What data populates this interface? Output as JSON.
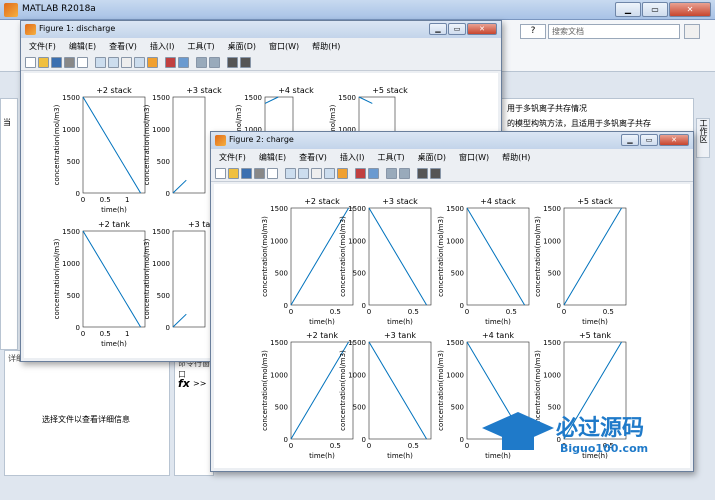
{
  "app": {
    "title": "MATLAB R2018a",
    "search_placeholder": "搜索文档",
    "help": "?"
  },
  "main": {
    "cmd_label": "命令行窗口",
    "fx": "fx",
    "prompt": ">>",
    "details_label": "详细信息",
    "select_hint": "选择文件以查看详细信息",
    "side_cut": "当",
    "doc_line1": "用于多钒离子共存情况",
    "doc_line2": "的模型构筑方法，且适用于多钒离子共存",
    "right_tab": "工作区"
  },
  "fig1": {
    "title": "Figure 1: discharge"
  },
  "fig2": {
    "title": "Figure 2: charge"
  },
  "menu": [
    "文件(F)",
    "编辑(E)",
    "查看(V)",
    "插入(I)",
    "工具(T)",
    "桌面(D)",
    "窗口(W)",
    "帮助(H)"
  ],
  "axes_common": {
    "ylabel": "concentration(mol/m3)",
    "xlabel": "time(h)",
    "yticks": [
      "0",
      "500",
      "1000",
      "1500"
    ]
  },
  "chart_data": [
    {
      "type": "line",
      "figure": "Figure 1: discharge",
      "title": "+2 stack",
      "x": [
        0,
        1.3
      ],
      "y": [
        1500,
        0
      ],
      "xlim": [
        0,
        1.4
      ],
      "ylim": [
        0,
        1500
      ],
      "xticks": [
        "0",
        "0.5",
        "1"
      ]
    },
    {
      "type": "line",
      "figure": "Figure 1: discharge",
      "title": "+3 stack",
      "x": [
        0,
        0.3
      ],
      "y": [
        0,
        200
      ],
      "xlim": [
        0,
        1.4
      ],
      "ylim": [
        0,
        1500
      ]
    },
    {
      "type": "line",
      "figure": "Figure 1: discharge",
      "title": "+4 stack",
      "x": [
        0,
        0.3
      ],
      "y": [
        1400,
        1500
      ],
      "xlim": [
        0,
        1.4
      ],
      "ylim": [
        0,
        1500
      ]
    },
    {
      "type": "line",
      "figure": "Figure 1: discharge",
      "title": "+5 stack",
      "x": [
        0,
        0.3
      ],
      "y": [
        1500,
        1400
      ],
      "xlim": [
        0,
        1.4
      ],
      "ylim": [
        0,
        1500
      ]
    },
    {
      "type": "line",
      "figure": "Figure 1: discharge",
      "title": "+2 tank",
      "x": [
        0,
        1.3
      ],
      "y": [
        1500,
        0
      ],
      "xlim": [
        0,
        1.4
      ],
      "ylim": [
        0,
        1500
      ],
      "xticks": [
        "0",
        "0.5",
        "1"
      ]
    },
    {
      "type": "line",
      "figure": "Figure 1: discharge",
      "title": "+3 tank",
      "x": [
        0,
        0.3
      ],
      "y": [
        0,
        200
      ],
      "xlim": [
        0,
        1.4
      ],
      "ylim": [
        0,
        1500
      ]
    },
    {
      "type": "line",
      "figure": "Figure 2: charge",
      "title": "+2 stack",
      "x": [
        0,
        0.65
      ],
      "y": [
        0,
        1500
      ],
      "xlim": [
        0,
        0.7
      ],
      "ylim": [
        0,
        1500
      ],
      "xticks": [
        "0",
        "0.5"
      ]
    },
    {
      "type": "line",
      "figure": "Figure 2: charge",
      "title": "+3 stack",
      "x": [
        0,
        0.65
      ],
      "y": [
        1500,
        0
      ],
      "xlim": [
        0,
        0.7
      ],
      "ylim": [
        0,
        1500
      ],
      "xticks": [
        "0",
        "0.5"
      ]
    },
    {
      "type": "line",
      "figure": "Figure 2: charge",
      "title": "+4 stack",
      "x": [
        0,
        0.65
      ],
      "y": [
        1500,
        0
      ],
      "xlim": [
        0,
        0.7
      ],
      "ylim": [
        0,
        1500
      ],
      "xticks": [
        "0",
        "0.5"
      ]
    },
    {
      "type": "line",
      "figure": "Figure 2: charge",
      "title": "+5 stack",
      "x": [
        0,
        0.65
      ],
      "y": [
        0,
        1500
      ],
      "xlim": [
        0,
        0.7
      ],
      "ylim": [
        0,
        1500
      ],
      "xticks": [
        "0",
        "0.5"
      ]
    },
    {
      "type": "line",
      "figure": "Figure 2: charge",
      "title": "+2 tank",
      "x": [
        0,
        0.65
      ],
      "y": [
        0,
        1500
      ],
      "xlim": [
        0,
        0.7
      ],
      "ylim": [
        0,
        1500
      ],
      "xticks": [
        "0",
        "0.5"
      ]
    },
    {
      "type": "line",
      "figure": "Figure 2: charge",
      "title": "+3 tank",
      "x": [
        0,
        0.65
      ],
      "y": [
        1500,
        0
      ],
      "xlim": [
        0,
        0.7
      ],
      "ylim": [
        0,
        1500
      ],
      "xticks": [
        "0",
        "0.5"
      ]
    },
    {
      "type": "line",
      "figure": "Figure 2: charge",
      "title": "+4 tank",
      "x": [
        0,
        0.65
      ],
      "y": [
        1500,
        0
      ],
      "xlim": [
        0,
        0.7
      ],
      "ylim": [
        0,
        1500
      ],
      "xticks": [
        "0",
        "0.5"
      ]
    },
    {
      "type": "line",
      "figure": "Figure 2: charge",
      "title": "+5 tank",
      "x": [
        0,
        0.65
      ],
      "y": [
        0,
        1500
      ],
      "xlim": [
        0,
        0.7
      ],
      "ylim": [
        0,
        1500
      ],
      "xticks": [
        "0",
        "0.5"
      ]
    }
  ],
  "watermark": {
    "text": "必过源码",
    "sub": "Biguo100.com"
  },
  "colors": {
    "line": "#0072bd",
    "accent": "#e06a1a"
  }
}
